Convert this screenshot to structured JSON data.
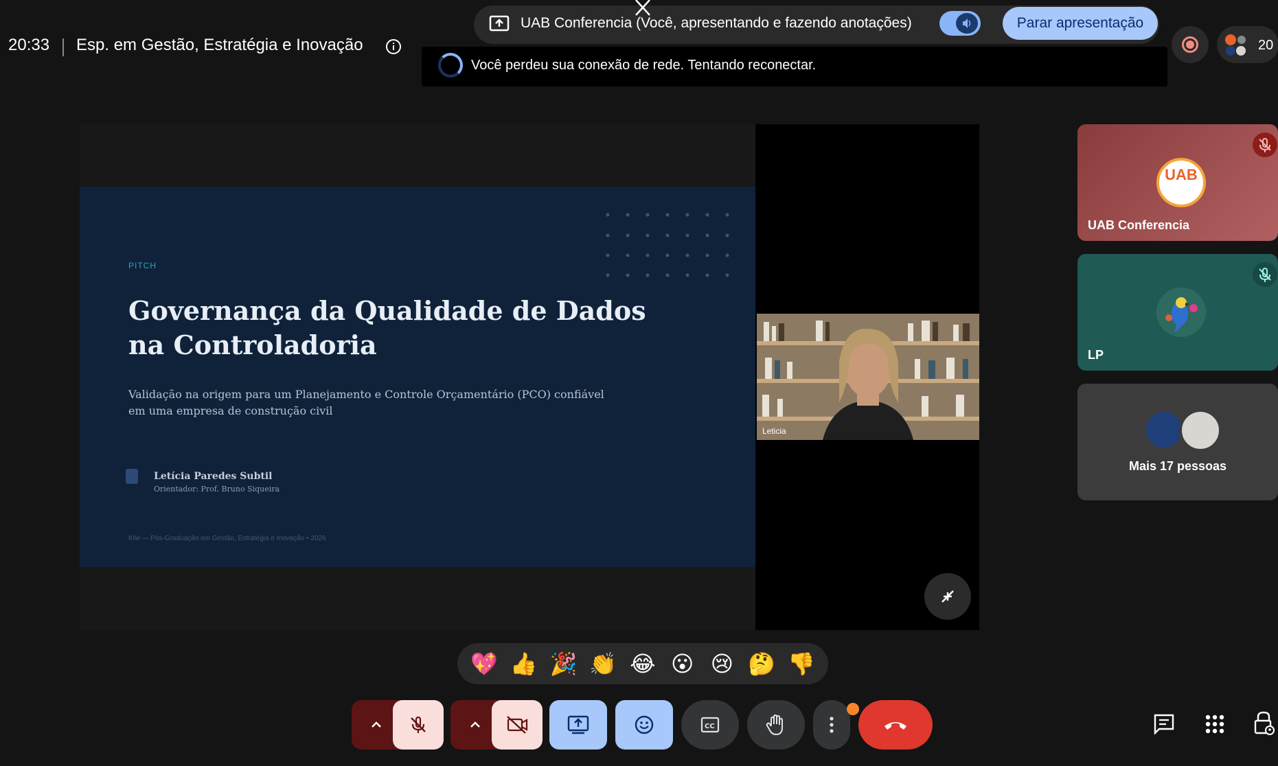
{
  "meeting": {
    "time": "20:33",
    "title": "Esp. em Gestão, Estratégia e Inovação"
  },
  "presenting": {
    "text": "UAB Conferencia (Você, apresentando e fazendo anotações)",
    "stop_label": "Parar apresentação"
  },
  "banner": {
    "text": "Você perdeu sua conexão de rede. Tentando reconectar."
  },
  "participants": {
    "count": "20"
  },
  "slide": {
    "label": "PITCH",
    "title": "Governança da Qualidade de Dados na Controladoria",
    "subtitle": "Validação na origem para um Planejamento e Controle Orçamentário (PCO) confiável em uma empresa de construção civil",
    "author": "Letícia Paredes Subtil",
    "advisor": "Orientador: Prof. Bruno Siqueira",
    "footer": "Kfw — Pós-Graduação em Gestão, Estratégia e Inovação • 2026"
  },
  "presenter": {
    "name": "Leticia"
  },
  "tiles": [
    {
      "name": "UAB Conferencia",
      "avatar_text": "UAB"
    },
    {
      "name": "LP"
    },
    {
      "name": "Mais 17 pessoas"
    }
  ],
  "reactions": [
    "💖",
    "👍",
    "🎉",
    "👏",
    "😂",
    "😮",
    "😢",
    "🤔",
    "👎"
  ],
  "colors": {
    "accent_blue": "#a8c7fa",
    "hangup_red": "#e0382e",
    "muted_red": "#f9dedc",
    "notification_orange": "#f9852b"
  }
}
